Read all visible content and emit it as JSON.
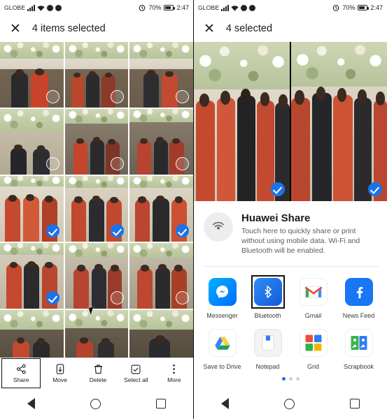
{
  "left": {
    "statusbar": {
      "carrier": "GLOBE",
      "alarm_icon": "alarm-icon",
      "battery_percent": "70%",
      "time": "2:47",
      "wifi_icon": "wifi-icon",
      "signal_icon": "signal-bars-icon",
      "dnd_icon": "do-not-disturb-icon",
      "sync_icon": "sync-icon"
    },
    "actionbar": {
      "close_label": "✕",
      "title": "4 items selected"
    },
    "grid": {
      "cells": [
        {
          "id": 1,
          "selected": false
        },
        {
          "id": 2,
          "selected": false
        },
        {
          "id": 3,
          "selected": false
        },
        {
          "id": 4,
          "selected": false
        },
        {
          "id": 5,
          "selected": false
        },
        {
          "id": 6,
          "selected": false
        },
        {
          "id": 7,
          "selected": true
        },
        {
          "id": 8,
          "selected": true
        },
        {
          "id": 9,
          "selected": true
        },
        {
          "id": 10,
          "selected": true
        },
        {
          "id": 11,
          "selected": false
        },
        {
          "id": 12,
          "selected": false
        },
        {
          "id": 13,
          "selected": false
        },
        {
          "id": 14,
          "selected": false
        },
        {
          "id": 15,
          "selected": false
        }
      ]
    },
    "toolbar": [
      {
        "label": "Share",
        "icon": "share-icon",
        "selected": true
      },
      {
        "label": "Move",
        "icon": "move-icon",
        "selected": false
      },
      {
        "label": "Delete",
        "icon": "trash-icon",
        "selected": false
      },
      {
        "label": "Select all",
        "icon": "select-all-icon",
        "selected": false
      },
      {
        "label": "More",
        "icon": "more-vertical-icon",
        "selected": false
      }
    ],
    "navbar": {
      "back": "back-icon",
      "home": "home-icon",
      "recents": "recents-icon"
    }
  },
  "right": {
    "statusbar": {
      "carrier": "GLOBE",
      "battery_percent": "70%",
      "time": "2:47"
    },
    "actionbar": {
      "close_label": "✕",
      "title": "4 selected"
    },
    "preview": {
      "items": [
        {
          "id": "preview-photo-1",
          "selected": true
        },
        {
          "id": "preview-photo-2",
          "selected": true
        }
      ]
    },
    "huawei_share": {
      "icon": "huawei-share-icon",
      "title": "Huawei Share",
      "description": "Touch here to quickly share or print without using mobile data. Wi-Fi and Bluetooth will be enabled."
    },
    "apps": [
      {
        "label": "Messenger",
        "icon": "messenger-icon",
        "color": "#0084ff",
        "selected": false
      },
      {
        "label": "Bluetooth",
        "icon": "bluetooth-icon",
        "color": "#1a73e8",
        "selected": true
      },
      {
        "label": "Gmail",
        "icon": "gmail-icon",
        "color": "#ffffff",
        "selected": false
      },
      {
        "label": "News Feed",
        "icon": "facebook-icon",
        "color": "#1877f2",
        "selected": false
      },
      {
        "label": "Save to Drive",
        "icon": "google-drive-icon",
        "color": "#ffffff",
        "selected": false
      },
      {
        "label": "Notepad",
        "icon": "notepad-icon",
        "color": "#f5f5f5",
        "selected": false
      },
      {
        "label": "Grid",
        "icon": "grid-icon",
        "color": "#ffffff",
        "selected": false
      },
      {
        "label": "Scrapbook",
        "icon": "scrapbook-icon",
        "color": "#ffffff",
        "selected": false
      }
    ],
    "pagination": {
      "pages": 3,
      "active": 1
    }
  },
  "colors": {
    "accent_blue": "#1a73e8",
    "selection_check": "#1a73e8",
    "sheet_bg": "#ffffff",
    "text_primary": "#1b1b1b",
    "text_secondary": "#5c5c5c"
  }
}
